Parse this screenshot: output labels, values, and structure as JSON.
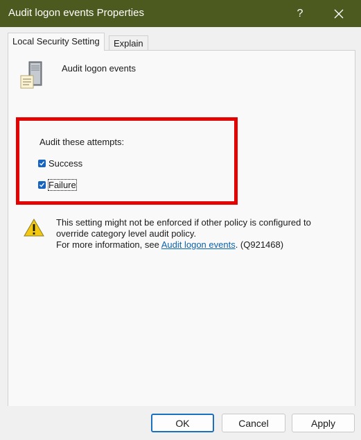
{
  "window": {
    "title": "Audit logon events Properties",
    "help_glyph": "?",
    "close_glyph": "✕"
  },
  "tabs": [
    {
      "label": "Local Security Setting"
    },
    {
      "label": "Explain"
    }
  ],
  "policy": {
    "name": "Audit logon events",
    "icon": "server-icon"
  },
  "audit": {
    "label": "Audit these attempts:",
    "success": {
      "label": "Success",
      "checked": true
    },
    "failure": {
      "label": "Failure",
      "checked": true
    }
  },
  "warning": {
    "icon": "warning-icon",
    "line1": "This setting might not be enforced if other policy is configured to",
    "line2": "override category level audit policy.",
    "line3_prefix": "For more information, see ",
    "link_text": "Audit logon events",
    "line3_suffix": ". (Q921468)"
  },
  "buttons": {
    "ok": "OK",
    "cancel": "Cancel",
    "apply": "Apply"
  },
  "colors": {
    "titlebar": "#4c5a1f",
    "highlight": "#e50000",
    "checkbox": "#1565c0",
    "link": "#0b63b0"
  }
}
